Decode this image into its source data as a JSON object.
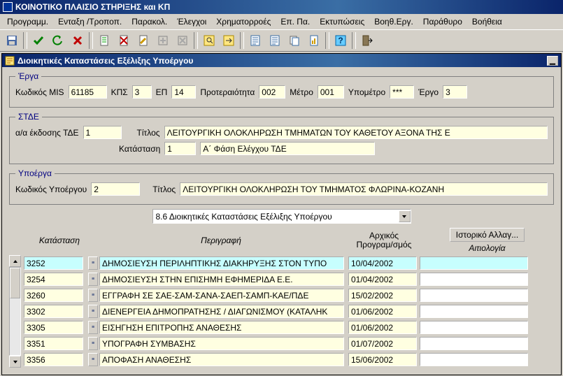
{
  "appTitle": "ΚΟΙΝΟΤΙΚΟ ΠΛΑΙΣΙΟ ΣΤΗΡΙΞΗΣ και ΚΠ",
  "menu": [
    "Προγραμμ.",
    "Ενταξη /Τροποπ.",
    "Παρακολ.",
    "Έλεγχοι",
    "Χρηματορροές",
    "Επ. Πα.",
    "Εκτυπώσεις",
    "Βοηθ.Εργ.",
    "Παράθυρο",
    "Βοήθεια"
  ],
  "subTitle": "Διοικητικές Καταστάσεις Εξέλιξης Υποέργου",
  "erga": {
    "legend": "Έργα",
    "mis_lbl": "Κωδικός MIS",
    "mis": "61185",
    "kps_lbl": "ΚΠΣ",
    "kps": "3",
    "ep_lbl": "ΕΠ",
    "ep": "14",
    "prio_lbl": "Προτεραιότητα",
    "prio": "002",
    "metro_lbl": "Μέτρο",
    "metro": "001",
    "ypometro_lbl": "Υπομέτρο",
    "ypometro": "***",
    "ergo_lbl": "Έργο",
    "ergo": "3"
  },
  "stde": {
    "legend": "ΣΤΔΕ",
    "aa_lbl": "α/α έκδοσης ΤΔΕ",
    "aa": "1",
    "title_lbl": "Τίτλος",
    "title": "ΛΕΙΤΟΥΡΓΙΚΗ ΟΛΟΚΛΗΡΩΣΗ ΤΜΗΜΑΤΩΝ ΤΟΥ ΚΑΘΕΤΟΥ ΑΞΟΝΑ ΤΗΣ Ε",
    "kat_lbl": "Κατάσταση",
    "kat": "1",
    "kat_desc": "Α΄ Φάση Ελέγχου ΤΔΕ"
  },
  "ypoerga": {
    "legend": "Υποέργα",
    "code_lbl": "Κωδικός Υποέργου",
    "code": "2",
    "title_lbl": "Τίτλος",
    "title": "ΛΕΙΤΟΥΡΓΙΚΗ ΟΛΟΚΛΗΡΩΣΗ ΤΟΥ ΤΜΗΜΑΤΟΣ ΦΛΩΡΙΝΑ-ΚΟΖΑΝΗ"
  },
  "dropdown": "8.6 Διοικητικές Καταστάσεις Εξέλιξης Υποέργου",
  "headers": {
    "h1": "Κατάσταση",
    "h2": "Περιγραφή",
    "h3a": "Αρχικός",
    "h3b": "Προγραμ/σμός",
    "btn": "Ιστορικό Αλλαγ...",
    "h4": "Αιτιολογία"
  },
  "rows": [
    {
      "code": "3252",
      "desc": "ΔΗΜΟΣΙΕΥΣΗ ΠΕΡΙΛΗΠΤΙΚΗΣ ΔΙΑΚΗΡΥΞΗΣ ΣΤΟΝ ΤΥΠΟ",
      "date": "10/04/2002",
      "reason": "",
      "hl": true
    },
    {
      "code": "3254",
      "desc": "ΔΗΜΟΣΙΕΥΣΗ ΣΤΗΝ ΕΠΙΣΗΜΗ ΕΦΗΜΕΡΙΔΑ Ε.Ε.",
      "date": "01/04/2002",
      "reason": "",
      "hl": false
    },
    {
      "code": "3260",
      "desc": "ΕΓΓΡΑΦΗ ΣΕ ΣΑΕ-ΣΑΜ-ΣΑΝΑ-ΣΑΕΠ-ΣΑΜΠ-ΚΑΕ/ΠΔΕ",
      "date": "15/02/2002",
      "reason": "",
      "hl": false
    },
    {
      "code": "3302",
      "desc": "ΔΙΕΝΕΡΓΕΙΑ ΔΗΜΟΠΡΑΤΗΣΗΣ / ΔΙΑΓΩΝΙΣΜΟΥ (ΚΑΤΑΛΗΚ",
      "date": "01/06/2002",
      "reason": "",
      "hl": false
    },
    {
      "code": "3305",
      "desc": "ΕΙΣΗΓΗΣΗ ΕΠΙΤΡΟΠΗΣ ΑΝΑΘΕΣΗΣ",
      "date": "01/06/2002",
      "reason": "",
      "hl": false
    },
    {
      "code": "3351",
      "desc": "ΥΠΟΓΡΑΦΗ ΣΥΜΒΑΣΗΣ",
      "date": "01/07/2002",
      "reason": "",
      "hl": false
    },
    {
      "code": "3356",
      "desc": "ΑΠΟΦΑΣΗ ΑΝΑΘΕΣΗΣ",
      "date": "15/06/2002",
      "reason": "",
      "hl": false
    }
  ]
}
